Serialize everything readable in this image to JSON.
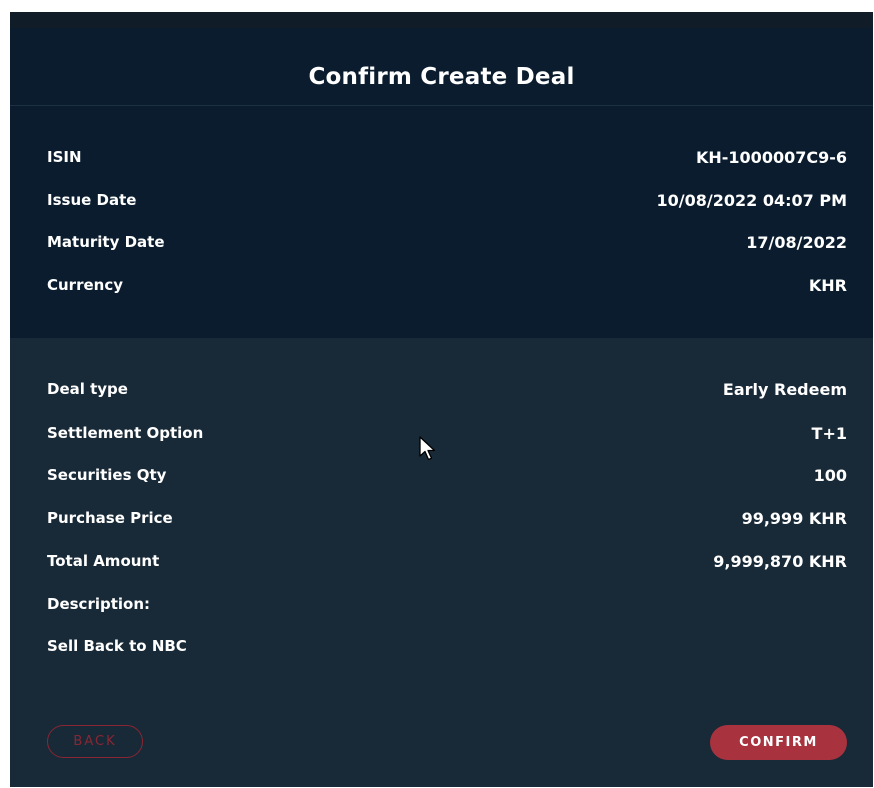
{
  "dialog": {
    "title": "Confirm Create Deal"
  },
  "security_info": [
    {
      "label": "ISIN",
      "value": "KH-1000007C9-6"
    },
    {
      "label": "Issue Date",
      "value": "10/08/2022 04:07 PM"
    },
    {
      "label": "Maturity Date",
      "value": "17/08/2022"
    },
    {
      "label": "Currency",
      "value": "KHR"
    }
  ],
  "deal_info": [
    {
      "label": "Deal type",
      "value": "Early Redeem"
    },
    {
      "label": "Settlement Option",
      "value": "T+1"
    },
    {
      "label": "Securities Qty",
      "value": "100"
    },
    {
      "label": "Purchase Price",
      "value": "99,999 KHR"
    },
    {
      "label": "Total Amount",
      "value": "9,999,870 KHR"
    }
  ],
  "description": {
    "label": "Description:",
    "text": "Sell Back to NBC"
  },
  "buttons": {
    "back": "BACK",
    "confirm": "CONFIRM"
  },
  "colors": {
    "header_bg": "#0a1c2e",
    "body_bg": "#182937",
    "accent": "#a8333e",
    "text": "#ffffff"
  },
  "icons": {
    "cursor": "mouse-pointer-icon"
  }
}
